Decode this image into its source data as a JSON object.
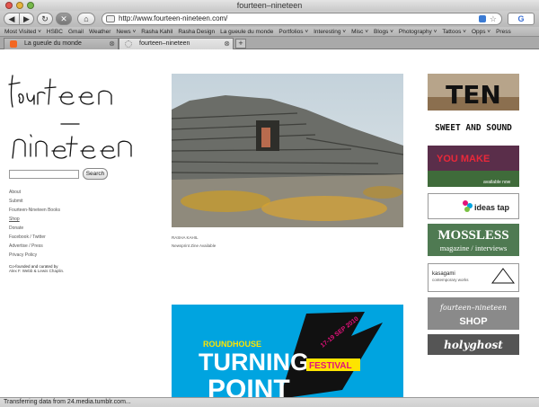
{
  "window": {
    "title": "fourteen–nineteen"
  },
  "toolbar": {
    "url": "http://www.fourteen-nineteen.com/"
  },
  "bookmarks": [
    "Most Visited ˅",
    "HSBC",
    "Gmail",
    "Weather",
    "News ˅",
    "Rasha Kahil",
    "Rasha Design",
    "La gueule du monde",
    "Portfolios ˅",
    "Interesting ˅",
    "Misc ˅",
    "Blogs ˅",
    "Photography ˅",
    "Tattoos ˅",
    "Opps ˅",
    "Press"
  ],
  "tabs": [
    {
      "label": "La gueule du monde"
    },
    {
      "label": "fourteen–nineteen"
    }
  ],
  "sidebar": {
    "logo_text": "fourteen–nineteen",
    "search_button": "Search",
    "nav": [
      "About",
      "Submit",
      "Fourteen-Nineteen Books",
      "Shop",
      "Donate",
      "Facebook / Twitter",
      "Advertise / Press",
      "Privacy Policy"
    ],
    "credit_line1": "Co-founded and curated by",
    "credit_line2": "Alex F. Webb & Lewis Chaplin."
  },
  "post": {
    "author": "RASHA KAHIL",
    "subtitle": "Newsprint Zine Available"
  },
  "poster": {
    "venue": "ROUNDHOUSE",
    "line1": "TURNING",
    "line2": "POINT",
    "tag": "FESTIVAL",
    "dates": "17-19 SEP 2010"
  },
  "ads": [
    {
      "name": "ten",
      "text": "TEN"
    },
    {
      "name": "sweet-and-sound",
      "text": "SWEET AND SOUND"
    },
    {
      "name": "you-make",
      "text": "YOU MAKE",
      "sub": "available now"
    },
    {
      "name": "ideas-tap",
      "text": "ideas tap"
    },
    {
      "name": "mossless",
      "text": "MOSSLESS",
      "sub": "magazine / interviews"
    },
    {
      "name": "kasagami",
      "text": "kasagami",
      "sub": "contemporary works"
    },
    {
      "name": "shop",
      "text": "fourteen–nineteen",
      "sub": "SHOP"
    },
    {
      "name": "holyghost",
      "text": "holyghost"
    }
  ],
  "statusbar": {
    "text": "Transferring data from 24.media.tumblr.com..."
  }
}
